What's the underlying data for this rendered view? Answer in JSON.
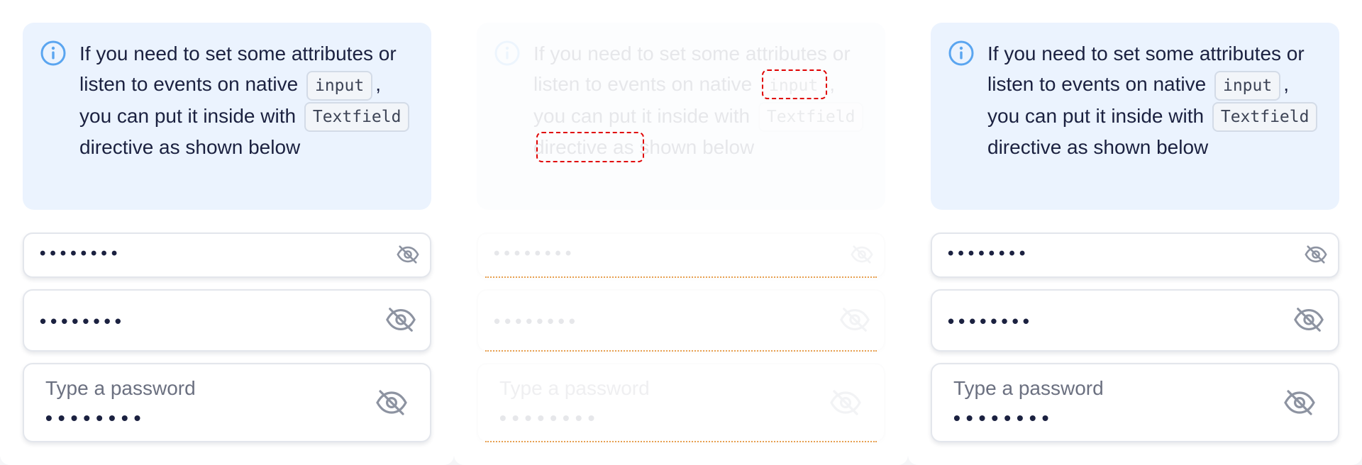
{
  "info": {
    "text_before_input": "If you need to set some attributes or listen to events on native",
    "code_input": "input",
    "text_between": ", you can put it inside with",
    "code_textfield": "Textfield",
    "text_after": "directive as shown below",
    "icon": "info-circle-icon"
  },
  "fields": {
    "password1_dots": "••••••••",
    "password2_dots": "••••••••",
    "password3_label": "Type a password",
    "password3_dots": "••••••••",
    "toggle_icon": "eye-off-icon"
  },
  "colors": {
    "info_bg": "#ebf3fe",
    "info_icon": "#5aa5f0",
    "text": "#1b2140",
    "muted": "#8d93a1",
    "highlight": "#e00000"
  }
}
